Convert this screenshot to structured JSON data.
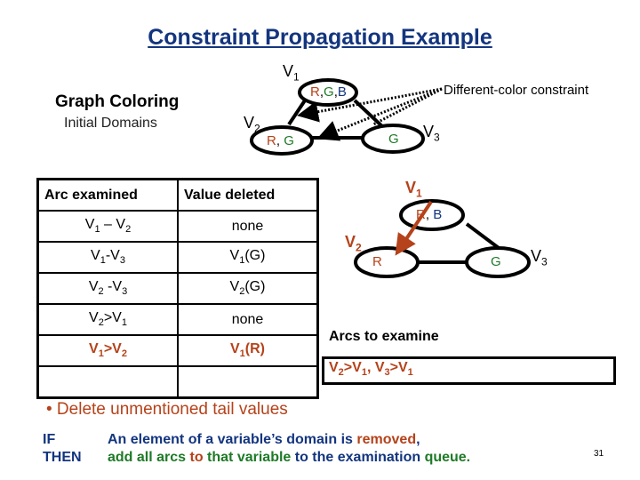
{
  "title": "Constraint Propagation Example",
  "graph_coloring": {
    "heading": "Graph Coloring",
    "subheading": "Initial Domains"
  },
  "constraint_label": "Different-color constraint",
  "top_graph": {
    "nodes": [
      {
        "name": "V",
        "sub": "1",
        "domain": [
          {
            "v": "R",
            "color": "#b5421a"
          },
          {
            "v": ",",
            "color": "#000000"
          },
          {
            "v": "G",
            "color": "#1e7a27"
          },
          {
            "v": ",",
            "color": "#000000"
          },
          {
            "v": "B",
            "color": "#13357f"
          }
        ]
      },
      {
        "name": "V",
        "sub": "2",
        "domain": [
          {
            "v": "R",
            "color": "#b5421a"
          },
          {
            "v": ", ",
            "color": "#000000"
          },
          {
            "v": "G",
            "color": "#1e7a27"
          }
        ]
      },
      {
        "name": "V",
        "sub": "3",
        "domain": [
          {
            "v": "G",
            "color": "#1e7a27"
          }
        ]
      }
    ]
  },
  "bottom_graph": {
    "nodes": [
      {
        "name": "V",
        "sub": "1",
        "domain": [
          {
            "v": "R",
            "color": "#b5421a"
          },
          {
            "v": ", ",
            "color": "#000000"
          },
          {
            "v": "B",
            "color": "#13357f"
          }
        ]
      },
      {
        "name": "V",
        "sub": "2",
        "domain": [
          {
            "v": "R",
            "color": "#b5421a"
          }
        ]
      },
      {
        "name": "V",
        "sub": "3",
        "domain": [
          {
            "v": "G",
            "color": "#1e7a27"
          }
        ]
      }
    ],
    "highlight_arc": "V1>V2"
  },
  "table": {
    "headers": [
      "Arc  examined",
      "Value deleted"
    ],
    "rows": [
      {
        "arc": [
          "V",
          "1",
          " – ",
          "V",
          "2"
        ],
        "deleted": "none",
        "highlight": false
      },
      {
        "arc": [
          "V",
          "1",
          "-",
          "V",
          "3"
        ],
        "deleted": [
          "V",
          "1",
          "(G)"
        ],
        "highlight": false
      },
      {
        "arc": [
          "V",
          "2",
          " -",
          "V",
          "3"
        ],
        "deleted": [
          "V",
          "2",
          "(G)"
        ],
        "highlight": false
      },
      {
        "arc": [
          "V",
          "2",
          ">",
          "V",
          "1"
        ],
        "deleted": "none",
        "highlight": false
      },
      {
        "arc": [
          "V",
          "1",
          ">",
          "V",
          "2"
        ],
        "deleted": [
          "V",
          "1",
          "(R)"
        ],
        "highlight": true
      },
      {
        "arc": "",
        "deleted": "",
        "highlight": false
      }
    ]
  },
  "queue": {
    "title": "Arcs to examine",
    "items": [
      [
        "V",
        "2",
        ">",
        "V",
        "1"
      ],
      [
        "V",
        "3",
        ">",
        "V",
        "1"
      ]
    ]
  },
  "bullet": "• Delete unmentioned tail values",
  "rule": {
    "if_key": "IF",
    "then_key": "THEN",
    "if_parts": [
      {
        "t": "An element of a variable’s domain is ",
        "color": "#13357f"
      },
      {
        "t": "removed",
        "color": "#b5421a"
      },
      {
        "t": ",",
        "color": "#13357f"
      }
    ],
    "then_parts": [
      {
        "t": "add all arcs ",
        "color": "#1e7a27"
      },
      {
        "t": "to",
        "color": "#b5421a"
      },
      {
        "t": " that variable",
        "color": "#1e7a27"
      },
      {
        "t": " to the examination ",
        "color": "#13357f"
      },
      {
        "t": "queue.",
        "color": "#1e7a27"
      }
    ]
  },
  "page_number": "31",
  "colors": {
    "title": "#13357f",
    "red": "#b5421a",
    "green": "#1e7a27",
    "blue": "#13357f"
  }
}
